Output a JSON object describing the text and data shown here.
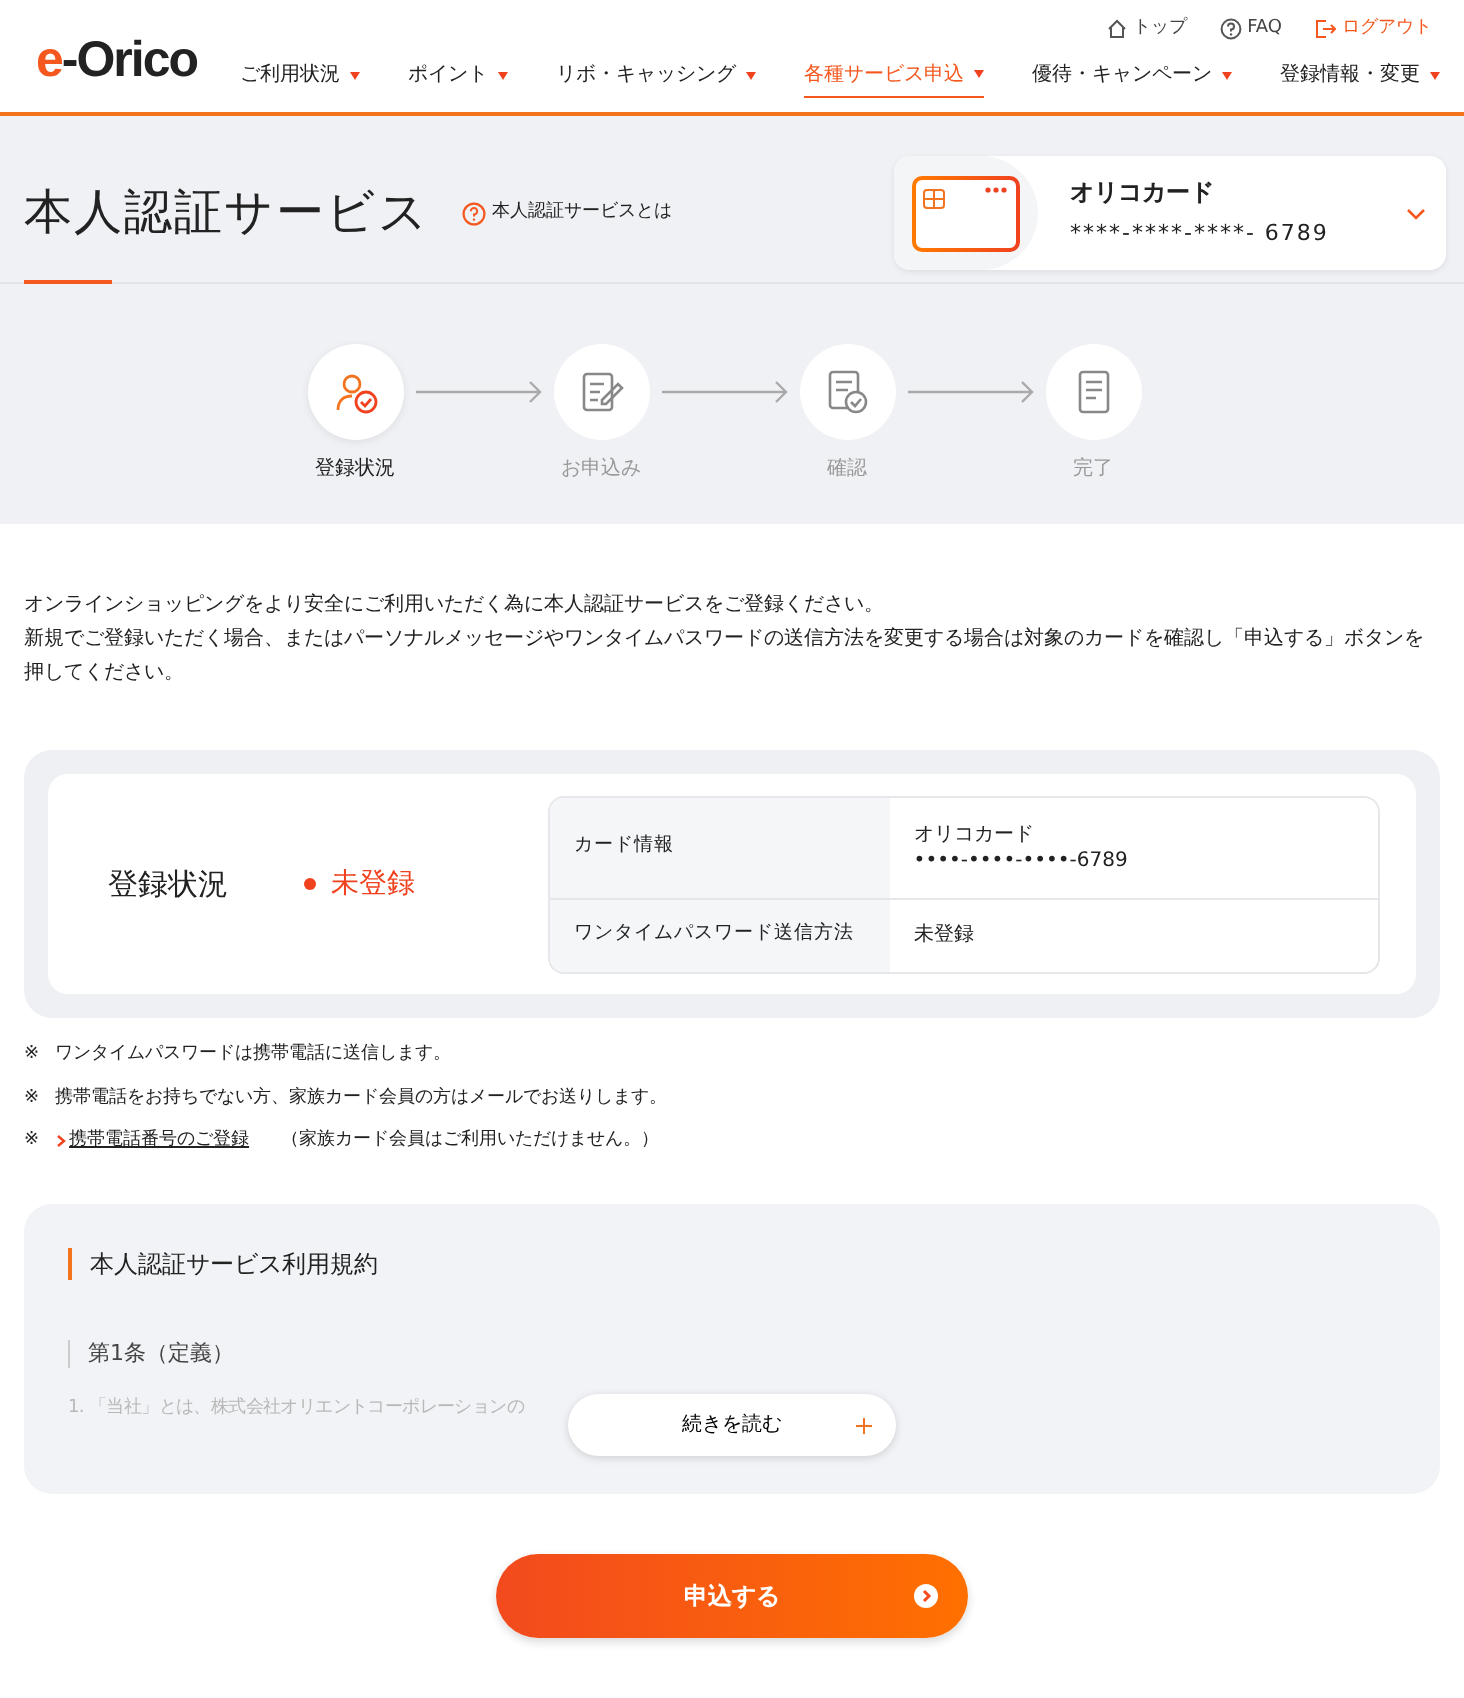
{
  "logo": {
    "mark": "e",
    "name": "-Orico"
  },
  "top_links": [
    {
      "kind": "home",
      "label": "トップ"
    },
    {
      "kind": "help",
      "label": "FAQ"
    },
    {
      "kind": "logout",
      "label": "ログアウト"
    }
  ],
  "nav": [
    {
      "label": "ご利用状況",
      "selected": false
    },
    {
      "label": "ポイント",
      "selected": false
    },
    {
      "label": "リボ・キャッシング",
      "selected": false
    },
    {
      "label": "各種サービス申込",
      "selected": true
    },
    {
      "label": "優待・キャンペーン",
      "selected": false
    },
    {
      "label": "登録情報・変更",
      "selected": false
    }
  ],
  "page_title": "本人認証サービス",
  "help_link": "本人認証サービスとは",
  "card_selector": {
    "name": "オリコカード",
    "number": "****-****-****- 6789"
  },
  "steps": [
    {
      "kind": "person",
      "label": "登録状況",
      "selected": true
    },
    {
      "kind": "form",
      "label": "お申込み",
      "selected": false
    },
    {
      "kind": "check",
      "label": "確認",
      "selected": false
    },
    {
      "kind": "doc",
      "label": "完了",
      "selected": false
    }
  ],
  "intro": [
    "オンラインショッピングをより安全にご利用いただく為に本人認証サービスをご登録ください。",
    "新規でご登録いただく場合、またはパーソナルメッセージやワンタイムパスワードの送信方法を変更する場合は対象のカードを確認し「申込する」ボタンを押してください。"
  ],
  "status": {
    "label": "登録状況",
    "value": "未登録",
    "color": "#f0421e",
    "rows": [
      {
        "label": "カード情報",
        "lines": [
          "オリコカード",
          "••••-••••-••••-6789"
        ]
      },
      {
        "label": "ワンタイムパスワード送信方法",
        "lines": [
          "未登録"
        ]
      }
    ]
  },
  "notes": [
    {
      "kind": "text",
      "mark": "※",
      "text": "ワンタイムパスワードは携帯電話に送信します。"
    },
    {
      "kind": "text",
      "mark": "※",
      "text": "携帯電話をお持ちでない方、家族カード会員の方はメールでお送りします。"
    },
    {
      "kind": "link",
      "mark": "※",
      "link": "携帯電話番号のご登録",
      "text": "（家族カード会員はご利用いただけません。）"
    }
  ],
  "terms": {
    "title": "本人認証サービス利用規約",
    "article": "第1条（定義）",
    "preview": "1. 「当社」とは、株式会社オリエントコーポレーションの",
    "more_button": "続きを読む"
  },
  "submit_button": "申込する"
}
